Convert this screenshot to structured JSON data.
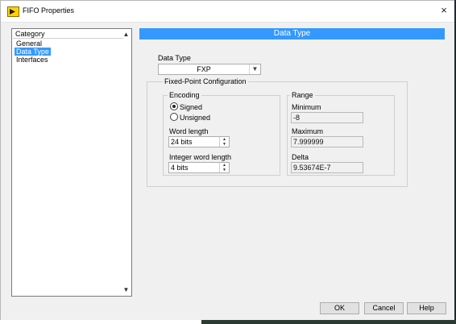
{
  "window": {
    "title": "FIFO Properties",
    "close_glyph": "×"
  },
  "sidebar": {
    "header": "Category",
    "items": [
      {
        "label": "General",
        "selected": false
      },
      {
        "label": "Data Type",
        "selected": true
      },
      {
        "label": "Interfaces",
        "selected": false
      }
    ],
    "scroll_up_glyph": "▲",
    "scroll_down_glyph": "▼"
  },
  "section": {
    "title": "Data Type"
  },
  "data_type": {
    "label": "Data Type",
    "value": "FXP",
    "arrow_glyph": "▼"
  },
  "fixed_point": {
    "caption": "Fixed-Point Configuration",
    "encoding": {
      "caption": "Encoding",
      "signed_label": "Signed",
      "unsigned_label": "Unsigned",
      "selected": "Signed",
      "word_length_label": "Word length",
      "word_length_value": "24 bits",
      "integer_word_length_label": "Integer word length",
      "integer_word_length_value": "4 bits",
      "spin_up_glyph": "▲",
      "spin_down_glyph": "▼"
    },
    "range": {
      "caption": "Range",
      "minimum_label": "Minimum",
      "minimum_value": "-8",
      "maximum_label": "Maximum",
      "maximum_value": "7.999999",
      "delta_label": "Delta",
      "delta_value": "9.53674E-7"
    }
  },
  "buttons": {
    "ok": "OK",
    "cancel": "Cancel",
    "help": "Help"
  }
}
